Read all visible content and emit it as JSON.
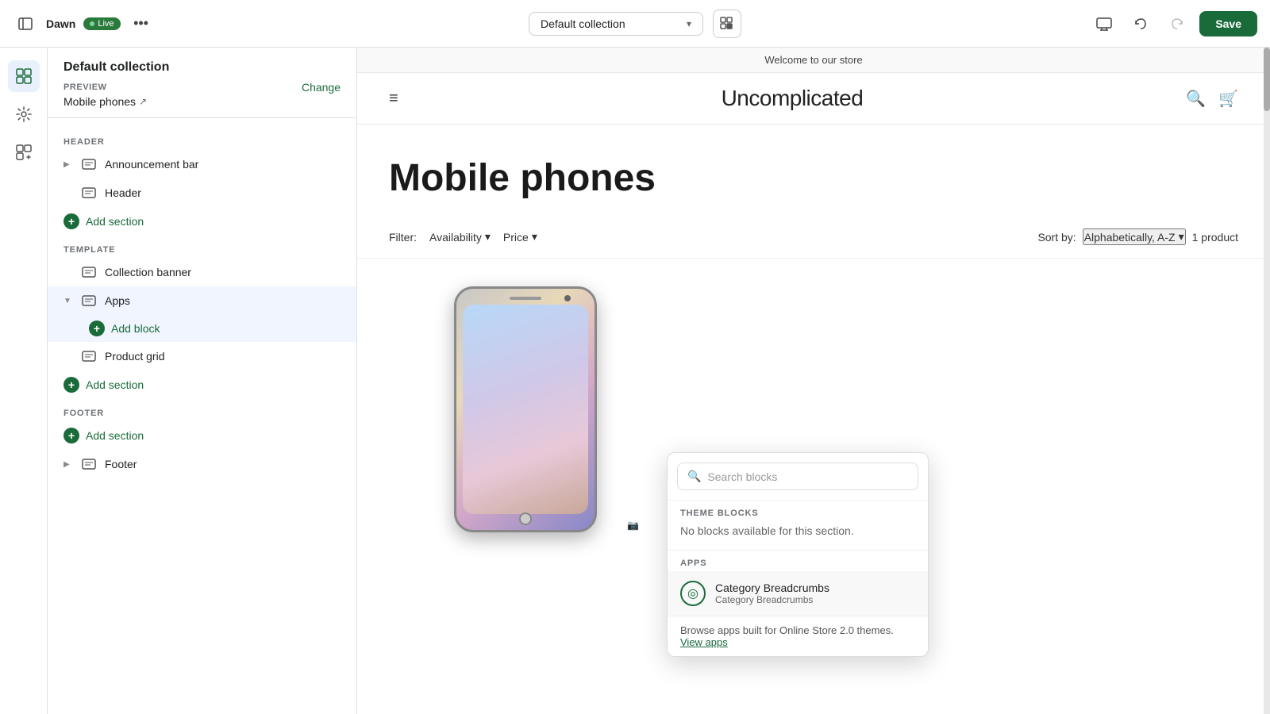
{
  "topbar": {
    "store_name": "Dawn",
    "live_label": "Live",
    "more_label": "•••",
    "dropdown_label": "Default collection",
    "save_label": "Save"
  },
  "sidebar": {
    "title": "Default collection",
    "preview_label": "PREVIEW",
    "change_label": "Change",
    "preview_value": "Mobile phones",
    "header_section_label": "HEADER",
    "template_section_label": "TEMPLATE",
    "footer_section_label": "FOOTER",
    "items": [
      {
        "id": "announcement-bar",
        "label": "Announcement bar",
        "icon": "▦",
        "has_chevron": true
      },
      {
        "id": "header",
        "label": "Header",
        "icon": "▦",
        "has_chevron": false
      },
      {
        "id": "add-section-header",
        "label": "Add section"
      },
      {
        "id": "collection-banner",
        "label": "Collection banner",
        "icon": "▦",
        "has_chevron": false
      },
      {
        "id": "apps",
        "label": "Apps",
        "icon": "▦",
        "has_chevron": true,
        "expanded": true
      },
      {
        "id": "add-block",
        "label": "Add block"
      },
      {
        "id": "product-grid",
        "label": "Product grid",
        "icon": "▦",
        "has_chevron": false
      },
      {
        "id": "add-section-template",
        "label": "Add section"
      },
      {
        "id": "add-section-footer",
        "label": "Add section"
      },
      {
        "id": "footer",
        "label": "Footer",
        "icon": "▦",
        "has_chevron": true
      }
    ]
  },
  "preview": {
    "announcement": "Welcome to our store",
    "brand": "Uncomplicated",
    "collection_title": "Mobile phones",
    "filter_label": "Filter:",
    "availability_label": "Availability",
    "price_label": "Price",
    "sort_label": "Sort by:",
    "sort_value": "Alphabetically, A-Z",
    "product_count": "1 product"
  },
  "popup": {
    "search_placeholder": "Search blocks",
    "theme_blocks_label": "THEME BLOCKS",
    "no_blocks_text": "No blocks available for this section.",
    "apps_label": "APPS",
    "app_name": "Category Breadcrumbs",
    "app_subtitle": "Category Breadcrumbs",
    "browse_text": "Browse apps built for Online Store 2.0 themes.",
    "view_apps_label": "View apps"
  },
  "nav_icons": [
    {
      "id": "sections",
      "icon": "⊞",
      "active": true
    },
    {
      "id": "customize",
      "icon": "✦",
      "active": false
    },
    {
      "id": "blocks",
      "icon": "⊕",
      "active": false
    }
  ]
}
